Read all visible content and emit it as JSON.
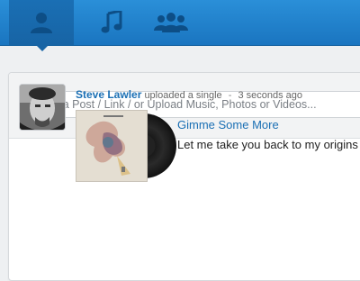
{
  "nav": {
    "tabs": [
      {
        "icon": "user-icon",
        "active": true
      },
      {
        "icon": "music-note-icon",
        "active": false
      },
      {
        "icon": "group-icon",
        "active": false
      }
    ]
  },
  "composer": {
    "placeholder": "Add a Post / Link / or Upload Music, Photos or Videos..."
  },
  "feed": {
    "items": [
      {
        "author": "Steve Lawler",
        "action": "uploaded a single",
        "separator": "-",
        "time": "3 seconds ago",
        "track_title": "Gimme Some More",
        "track_description": "Let me take you back to my origins"
      }
    ]
  },
  "colors": {
    "nav_blue": "#1a75c0",
    "link_blue": "#1a6fb4",
    "background": "#eef0f2"
  }
}
